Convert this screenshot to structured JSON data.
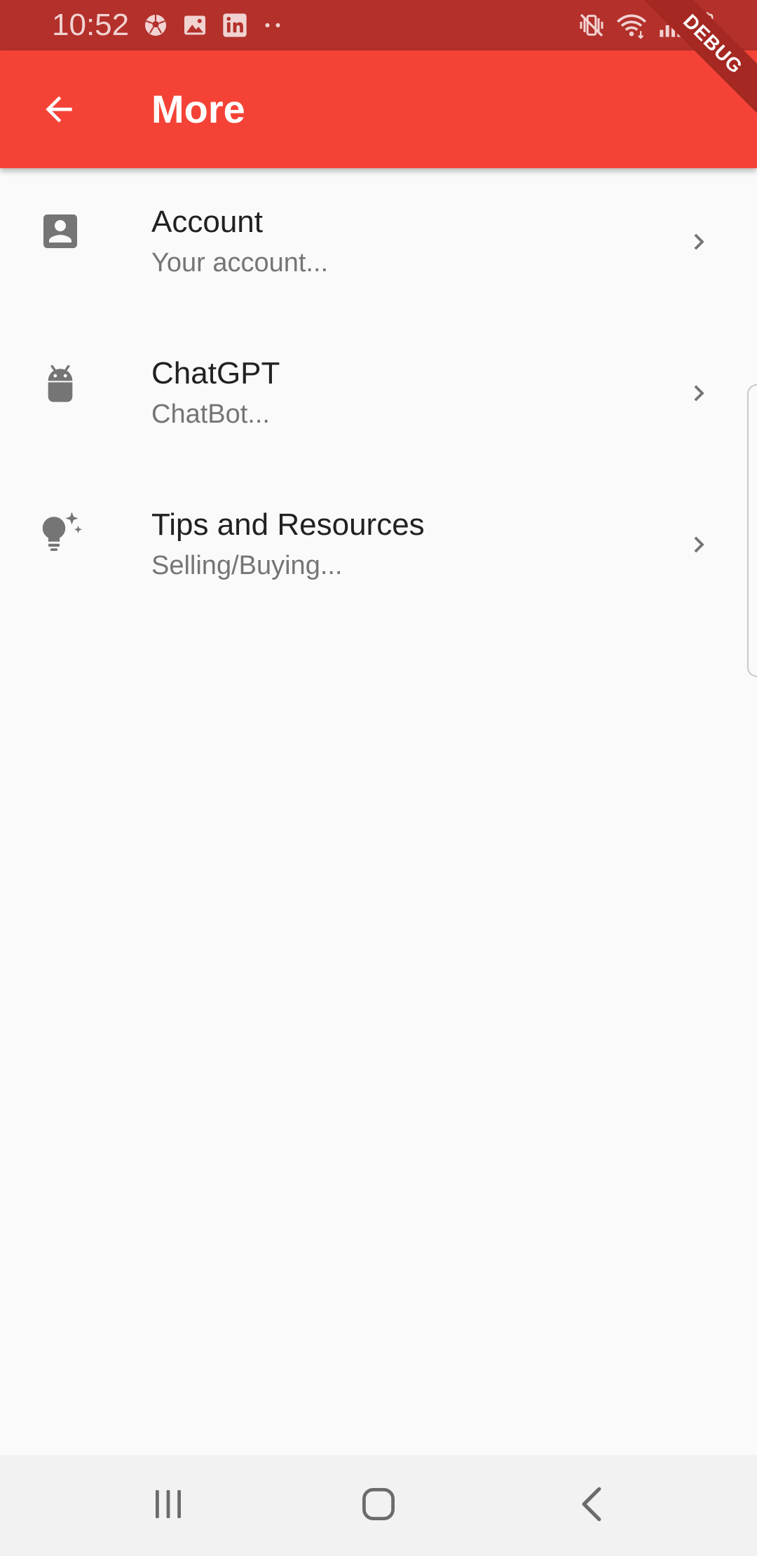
{
  "status_bar": {
    "time": "10:52",
    "left_icons": [
      "soccer-ball-icon",
      "image-icon",
      "linkedin-icon",
      "more-dots-icon"
    ],
    "right_icons": [
      "vibrate-mute-icon",
      "wifi-icon",
      "signal-icon",
      "battery-icon"
    ]
  },
  "app_bar": {
    "title": "More",
    "back_icon": "arrow-back-icon",
    "background_color": "#f44336"
  },
  "debug_banner": {
    "label": "DEBUG"
  },
  "list": {
    "items": [
      {
        "title": "Account",
        "subtitle": "Your account...",
        "icon": "account-box-icon"
      },
      {
        "title": "ChatGPT",
        "subtitle": "ChatBot...",
        "icon": "android-icon"
      },
      {
        "title": "Tips and Resources",
        "subtitle": "Selling/Buying...",
        "icon": "tips-lightbulb-icon"
      }
    ],
    "trailing_icon": "chevron-right-icon"
  },
  "nav_bar": {
    "buttons": [
      "recent-apps-icon",
      "home-icon",
      "back-nav-icon"
    ]
  }
}
